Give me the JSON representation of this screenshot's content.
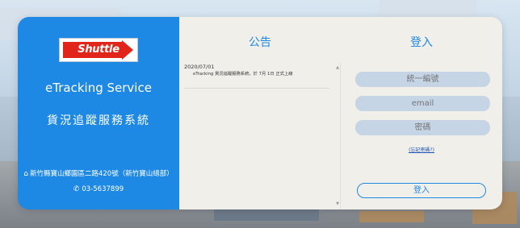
{
  "brand": {
    "logo_text": "Shuttle",
    "title": "eTracking Service",
    "subtitle": "貨況追蹤服務系統",
    "address": "新竹縣寶山鄉園區二路420號（新竹寶山總部）",
    "phone": "03-5637899"
  },
  "news": {
    "title": "公告",
    "items": [
      {
        "date": "2020/07/01",
        "text": "eTracking 貨況追蹤服務系統，於 7月 1日 正式上線"
      }
    ]
  },
  "login": {
    "title": "登入",
    "fields": [
      {
        "placeholder": "統一編號"
      },
      {
        "placeholder": "email"
      },
      {
        "placeholder": "密碼"
      }
    ],
    "forgot_label": "(忘記密碼?)",
    "submit_label": "登入"
  },
  "icons": {
    "home": "home-icon",
    "phone": "phone-icon"
  },
  "colors": {
    "brand_blue": "#1e88e5",
    "panel_bg": "#f0efe9",
    "logo_red": "#e1251b"
  }
}
